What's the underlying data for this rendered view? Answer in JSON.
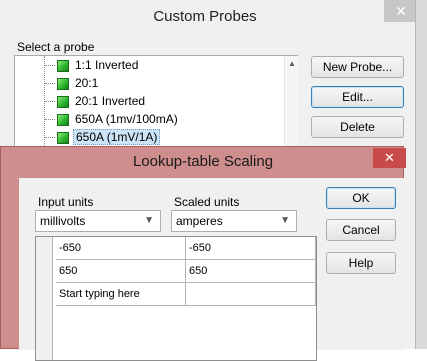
{
  "probes_window": {
    "title": "Custom Probes",
    "close_glyph": "✕",
    "select_label": "Select a probe",
    "probes": [
      {
        "label": "1:1 Inverted",
        "selected": false
      },
      {
        "label": "20:1",
        "selected": false
      },
      {
        "label": "20:1 Inverted",
        "selected": false
      },
      {
        "label": "650A (1mv/100mA)",
        "selected": false
      },
      {
        "label": "650A (1mV/1A)",
        "selected": true
      }
    ],
    "buttons": {
      "new_probe": "New Probe...",
      "edit": "Edit...",
      "delete": "Delete"
    },
    "probe_icon": "probe-green-icon"
  },
  "lookup_dialog": {
    "title": "Lookup-table Scaling",
    "close_glyph": "✕",
    "input_units_label": "Input units",
    "input_units_value": "millivolts",
    "scaled_units_label": "Scaled units",
    "scaled_units_value": "amperes",
    "dropdown_glyph": "▼",
    "table_rows": [
      {
        "input": "-650",
        "scaled": "-650"
      },
      {
        "input": "650",
        "scaled": "650"
      },
      {
        "input": "Start typing here",
        "scaled": ""
      }
    ],
    "buttons": {
      "ok": "OK",
      "cancel": "Cancel",
      "help": "Help"
    },
    "accent_color": "#cf8e8e",
    "close_color": "#c94a4a"
  }
}
